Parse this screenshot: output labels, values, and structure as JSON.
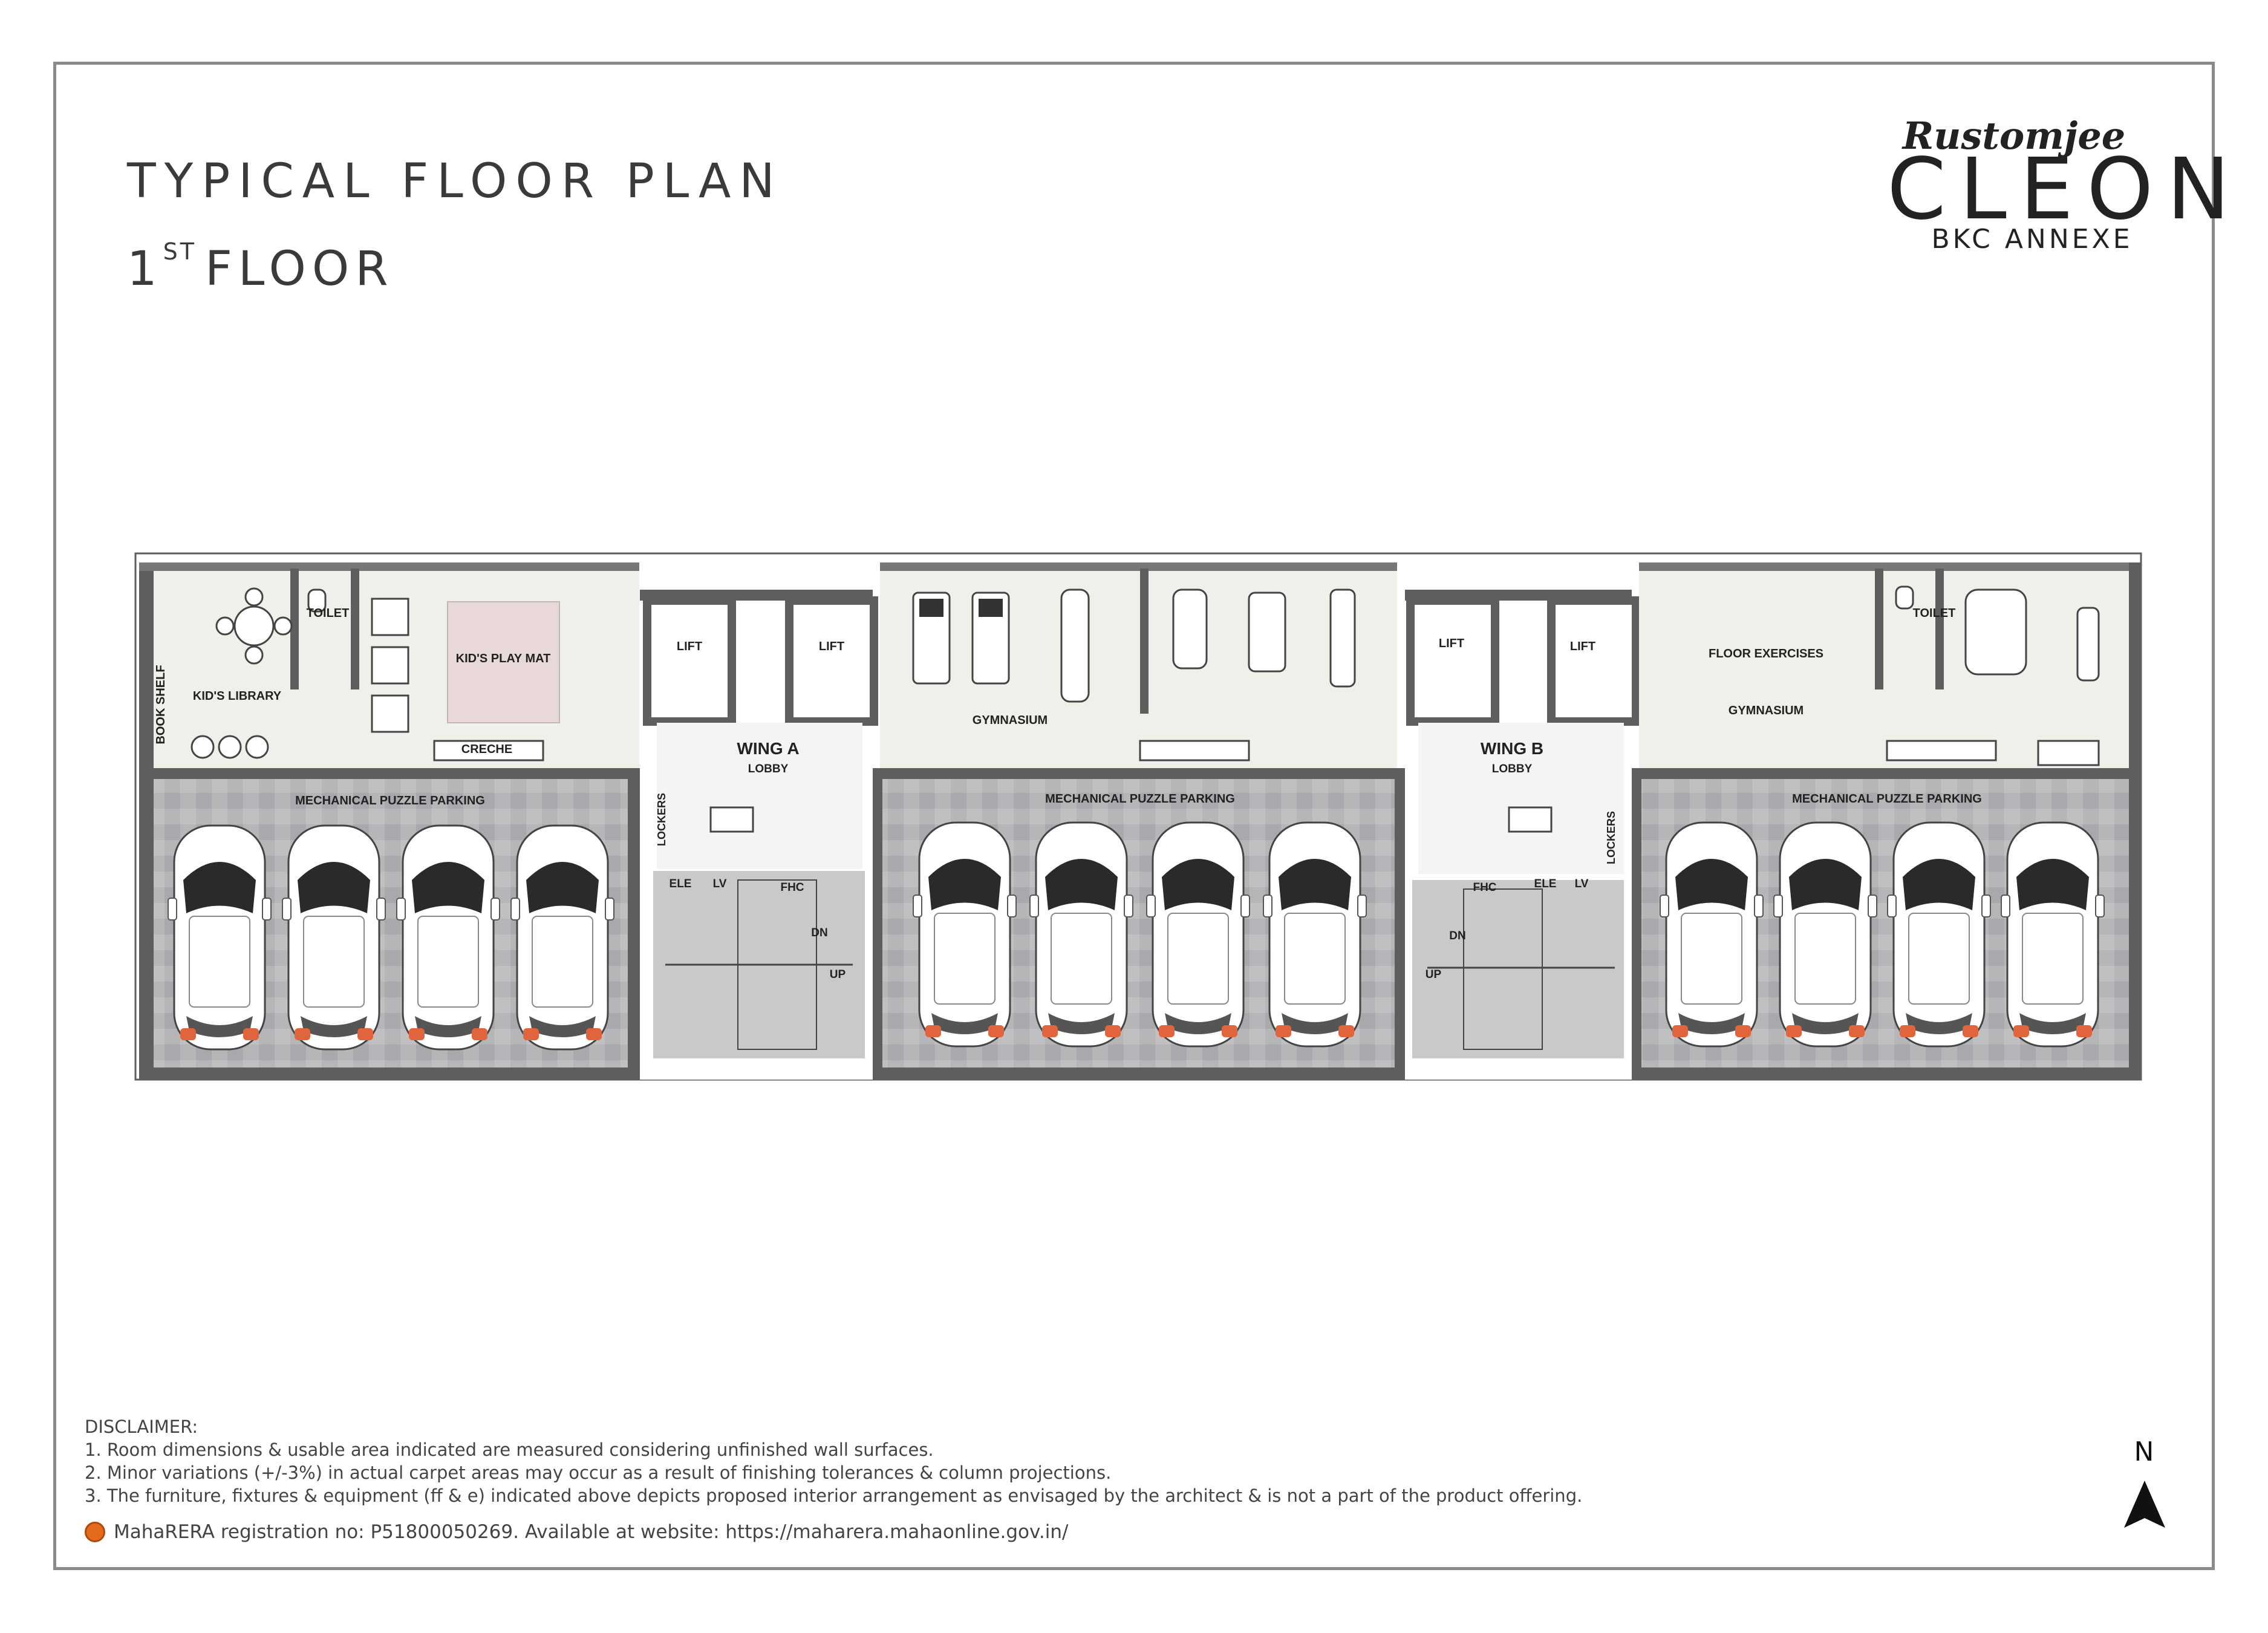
{
  "title": "TYPICAL FLOOR PLAN",
  "floor": {
    "number": "1",
    "suffix": "ST",
    "label": "FLOOR"
  },
  "brand": {
    "name": "Rustomjee",
    "project": "CLEON",
    "location": "BKC ANNEXE"
  },
  "plan_labels": {
    "book_shelf": "BOOK SHELF",
    "kids_library": "KID'S LIBRARY",
    "toilet_a": "TOILET",
    "creche": "CRECHE",
    "kids_play_mat": "KID'S PLAY MAT",
    "lift_a1": "LIFT",
    "lift_a2": "LIFT",
    "wing_a": "WING A",
    "lobby_a": "LOBBY",
    "lockers_a": "LOCKERS",
    "ele_a": "ELE",
    "lv_a": "LV",
    "fhc_a": "FHC",
    "dn_a": "DN",
    "up_a": "UP",
    "gym_a": "GYMNASIUM",
    "parking_1": "MECHANICAL PUZZLE PARKING",
    "parking_2": "MECHANICAL PUZZLE PARKING",
    "parking_3": "MECHANICAL PUZZLE PARKING",
    "lift_b1": "LIFT",
    "lift_b2": "LIFT",
    "wing_b": "WING B",
    "lobby_b": "LOBBY",
    "lockers_b": "LOCKERS",
    "fhc_b": "FHC",
    "ele_b": "ELE",
    "lv_b": "LV",
    "dn_b": "DN",
    "up_b": "UP",
    "floor_exercises": "FLOOR EXERCISES",
    "gym_b": "GYMNASIUM",
    "toilet_b": "TOILET"
  },
  "disclaimer": {
    "heading": "DISCLAIMER:",
    "items": [
      "1. Room dimensions & usable area indicated are measured considering unfinished wall surfaces.",
      "2. Minor variations (+/-3%) in actual carpet areas may occur as a result of finishing tolerances & column projections.",
      "3. The furniture, fixtures & equipment (ff & e) indicated above depicts proposed interior arrangement as envisaged by the architect & is not a part of the product offering."
    ]
  },
  "rera": "MahaRERA registration no: P51800050269. Available at website: https://maharera.mahaonline.gov.in/",
  "north_label": "N",
  "colors": {
    "wall": "#5e5e5e",
    "floor_light": "#eef0ea",
    "parking_tile": "#b3b3b6",
    "play_mat": "#e9d8d8",
    "car_body": "#ffffff",
    "car_light": "#e0643c"
  }
}
